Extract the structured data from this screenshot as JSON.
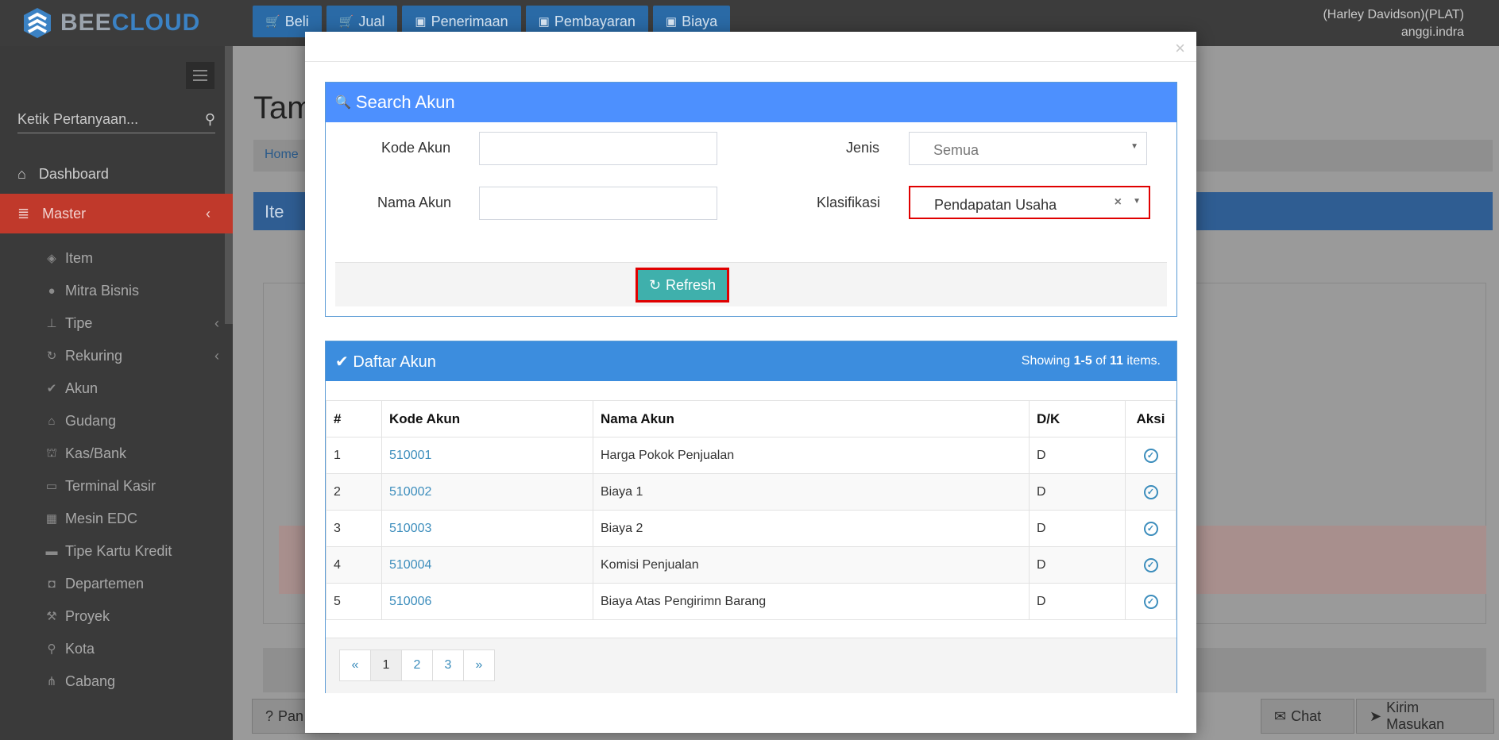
{
  "brand": {
    "part1": "BEE",
    "part2": "CLOUD"
  },
  "topnav": [
    {
      "label": "Beli",
      "icon": "cart-icon"
    },
    {
      "label": "Jual",
      "icon": "cart-icon"
    },
    {
      "label": "Penerimaan",
      "icon": "money-icon"
    },
    {
      "label": "Pembayaran",
      "icon": "money-icon"
    },
    {
      "label": "Biaya",
      "icon": "money-icon"
    }
  ],
  "user": {
    "company": "(Harley Davidson)(PLAT)",
    "name": "anggi.indra"
  },
  "sidebar": {
    "search_placeholder": "Ketik Pertanyaan...",
    "menu": [
      {
        "label": "Dashboard",
        "icon": "home-icon"
      },
      {
        "label": "Master",
        "icon": "database-icon"
      }
    ],
    "sub": [
      {
        "label": "Item",
        "icon": "cube-icon"
      },
      {
        "label": "Mitra Bisnis",
        "icon": "users-icon"
      },
      {
        "label": "Tipe",
        "icon": "sitemap-icon"
      },
      {
        "label": "Rekuring",
        "icon": "refresh-icon"
      },
      {
        "label": "Akun",
        "icon": "check-icon"
      },
      {
        "label": "Gudang",
        "icon": "home-icon"
      },
      {
        "label": "Kas/Bank",
        "icon": "bank-icon"
      },
      {
        "label": "Terminal Kasir",
        "icon": "monitor-icon"
      },
      {
        "label": "Mesin EDC",
        "icon": "calculator-icon"
      },
      {
        "label": "Tipe Kartu Kredit",
        "icon": "credit-card-icon"
      },
      {
        "label": "Departemen",
        "icon": "briefcase-icon"
      },
      {
        "label": "Proyek",
        "icon": "gavel-icon"
      },
      {
        "label": "Kota",
        "icon": "map-marker-icon"
      },
      {
        "label": "Cabang",
        "icon": "flow-icon"
      }
    ]
  },
  "background": {
    "title": "Tam",
    "breadcrumb": "Home",
    "box_title": "Ite",
    "footer_left": "Pan",
    "chat": "Chat",
    "feedback": "Kirim Masukan"
  },
  "search": {
    "title": "Search Akun",
    "kode_label": "Kode Akun",
    "kode_value": "",
    "nama_label": "Nama Akun",
    "nama_value": "",
    "jenis_label": "Jenis",
    "jenis_value": "Semua",
    "klasifikasi_label": "Klasifikasi",
    "klasifikasi_value": "Pendapatan Usaha",
    "refresh_label": "Refresh"
  },
  "list": {
    "title": "Daftar Akun",
    "summary_prefix": "Showing ",
    "summary_range": "1-5",
    "summary_of": " of ",
    "summary_total": "11",
    "summary_suffix": " items.",
    "headers": [
      "#",
      "Kode Akun",
      "Nama Akun",
      "D/K",
      "Aksi"
    ],
    "rows": [
      {
        "no": "1",
        "kode": "510001",
        "nama": "Harga Pokok Penjualan",
        "dk": "D"
      },
      {
        "no": "2",
        "kode": "510002",
        "nama": "Biaya 1",
        "dk": "D"
      },
      {
        "no": "3",
        "kode": "510003",
        "nama": "Biaya 2",
        "dk": "D"
      },
      {
        "no": "4",
        "kode": "510004",
        "nama": "Komisi Penjualan",
        "dk": "D"
      },
      {
        "no": "5",
        "kode": "510006",
        "nama": "Biaya Atas Pengirimn Barang",
        "dk": "D"
      }
    ],
    "pages": [
      "«",
      "1",
      "2",
      "3",
      "»"
    ]
  }
}
